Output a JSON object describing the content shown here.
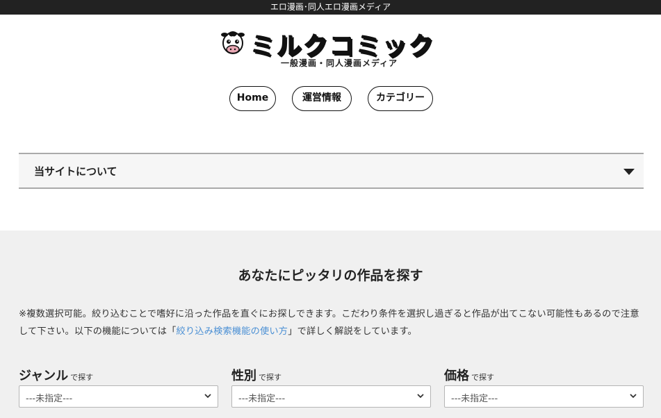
{
  "topbar": {
    "text": "エロ漫画･同人エロ漫画メディア"
  },
  "logo": {
    "name": "ミルクコミック",
    "tagline": "一般漫画・同人漫画メディア"
  },
  "nav": {
    "items": [
      {
        "label": "Home"
      },
      {
        "label": "運営情報"
      },
      {
        "label": "カテゴリー"
      }
    ]
  },
  "about": {
    "title": "当サイトについて",
    "icon": "triangle-down-icon"
  },
  "search": {
    "title": "あなたにピッタリの作品を探す",
    "desc_before": "※複数選択可能。絞り込むことで嗜好に沿った作品を直ぐにお探しできます。こだわり条件を選択し過ぎると作品が出てこない可能性もあるので注意して下さい。以下の機能については「",
    "desc_link": "絞り込み検索機能の使い方",
    "desc_after": "」で詳しく解説をしています。",
    "filters": [
      {
        "title": "ジャンル",
        "suffix": "で探す",
        "value": "---未指定---"
      },
      {
        "title": "性別",
        "suffix": "で探す",
        "value": "---未指定---"
      },
      {
        "title": "価格",
        "suffix": "で探す",
        "value": "---未指定---"
      }
    ]
  },
  "colors": {
    "topbar_bg": "#222222",
    "section_bg": "#f0f0f0",
    "link": "#4a8fd4"
  }
}
